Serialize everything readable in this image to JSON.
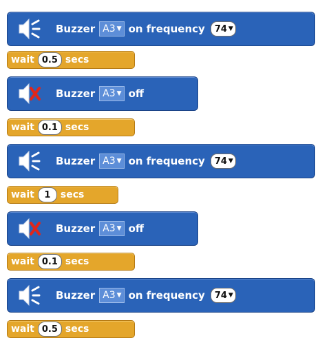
{
  "blocks": [
    {
      "type": "buzzer_on",
      "label": "Buzzer",
      "port": "A3",
      "action": "on frequency",
      "frequency": "74",
      "icon": "speaker-sound-icon"
    },
    {
      "type": "wait",
      "label": "wait",
      "value": "0.5",
      "unit": "secs"
    },
    {
      "type": "buzzer_off",
      "label": "Buzzer",
      "port": "A3",
      "action": "off",
      "icon": "speaker-mute-icon"
    },
    {
      "type": "wait",
      "label": "wait",
      "value": "0.1",
      "unit": "secs"
    },
    {
      "type": "buzzer_on",
      "label": "Buzzer",
      "port": "A3",
      "action": "on frequency",
      "frequency": "74",
      "icon": "speaker-sound-icon"
    },
    {
      "type": "wait",
      "label": "wait",
      "value": "1",
      "unit": "secs"
    },
    {
      "type": "buzzer_off",
      "label": "Buzzer",
      "port": "A3",
      "action": "off",
      "icon": "speaker-mute-icon"
    },
    {
      "type": "wait",
      "label": "wait",
      "value": "0.1",
      "unit": "secs"
    },
    {
      "type": "buzzer_on",
      "label": "Buzzer",
      "port": "A3",
      "action": "on frequency",
      "frequency": "74",
      "icon": "speaker-sound-icon"
    },
    {
      "type": "wait",
      "label": "wait",
      "value": "0.5",
      "unit": "secs"
    }
  ],
  "colors": {
    "motion_block": "#2a63b8",
    "control_block": "#e4a62b",
    "mute_x": "#e0261b"
  }
}
